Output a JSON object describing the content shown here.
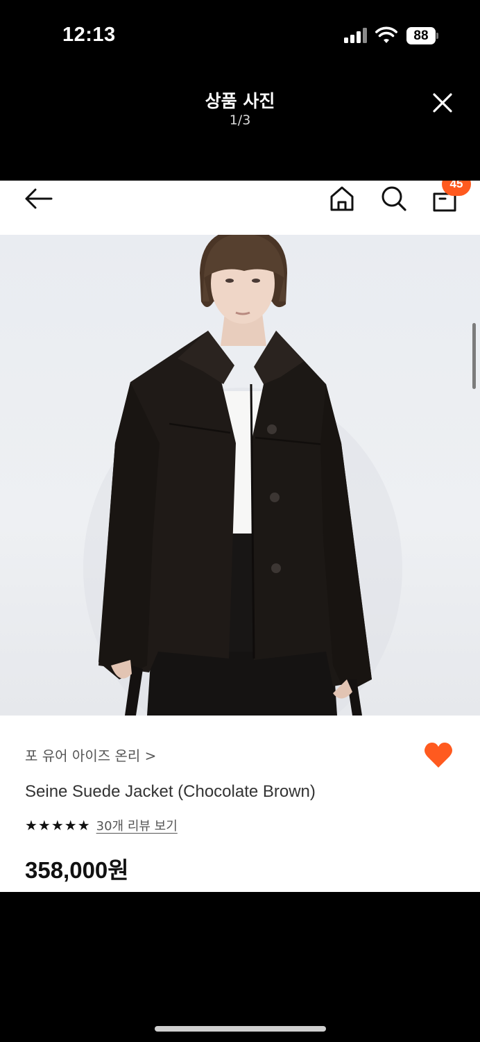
{
  "status_bar": {
    "time": "12:13",
    "battery": "88"
  },
  "viewer": {
    "title": "상품 사진",
    "counter": "1/3"
  },
  "app_nav": {
    "cart_count": "45"
  },
  "product": {
    "brand": "포 유어 아이즈 온리 >",
    "name": "Seine Suede Jacket (Chocolate Brown)",
    "rating_stars": "★★★★★",
    "review_link": "30개 리뷰 보기",
    "price": "358,000원",
    "favorited": true
  },
  "colors": {
    "accent": "#ff5a1f",
    "heart": "#ff5a1f"
  },
  "icons": [
    "back-arrow-icon",
    "home-icon",
    "search-icon",
    "shopping-bag-icon",
    "heart-icon",
    "close-icon"
  ]
}
